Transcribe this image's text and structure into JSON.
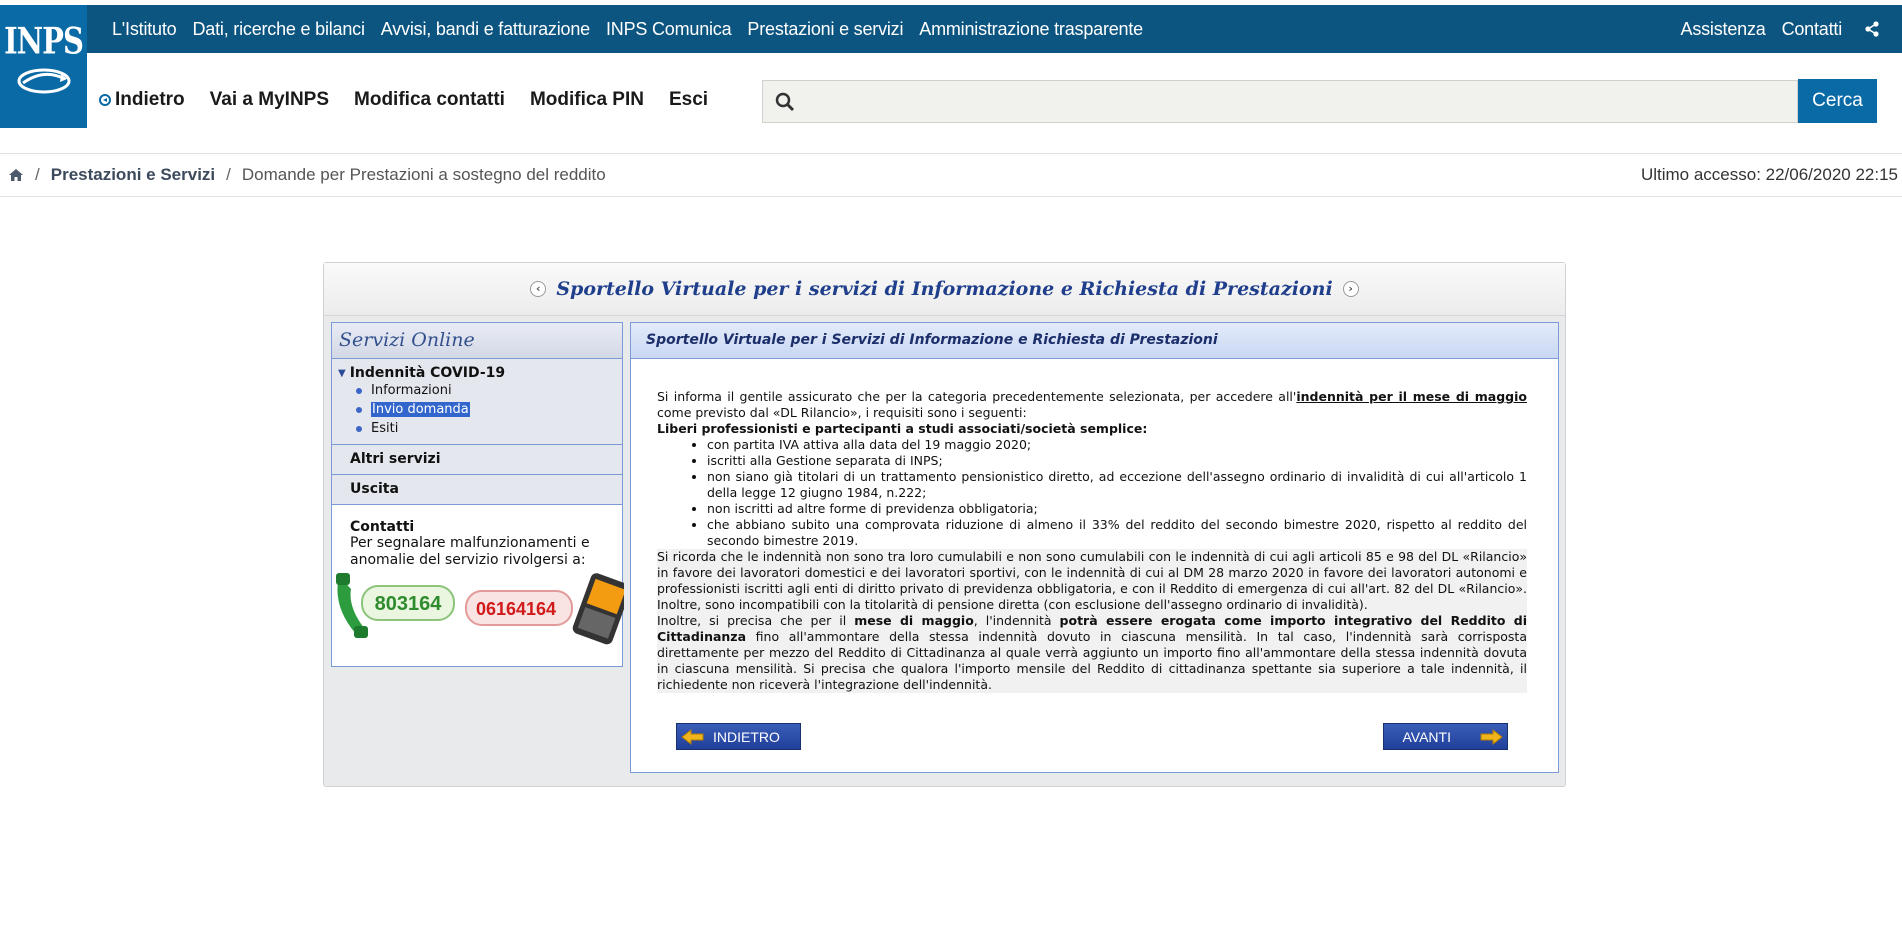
{
  "logo": {
    "text": "INPS"
  },
  "topnav": {
    "items": [
      "L'Istituto",
      "Dati, ricerche e bilanci",
      "Avvisi, bandi e fatturazione",
      "INPS Comunica",
      "Prestazioni e servizi",
      "Amministrazione trasparente"
    ],
    "assistenza": "Assistenza",
    "contatti": "Contatti",
    "share_icon": "share-icon"
  },
  "subnav": {
    "back": "Indietro",
    "myinps": "Vai a MyINPS",
    "contacts": "Modifica contatti",
    "pin": "Modifica PIN",
    "exit": "Esci"
  },
  "search": {
    "placeholder": "",
    "value": "",
    "button": "Cerca"
  },
  "breadcrumb": {
    "home_icon": "home-icon",
    "section": "Prestazioni e Servizi",
    "current": "Domande per Prestazioni a sostegno del reddito"
  },
  "last_access": "Ultimo accesso: 22/06/2020 22:15",
  "panel": {
    "title": "Sportello Virtuale per i servizi di Informazione e Richiesta di Prestazioni"
  },
  "sidebar": {
    "title": "Servizi Online",
    "group": "Indennità COVID-19",
    "sub_items": [
      "Informazioni",
      "Invio domanda",
      "Esiti"
    ],
    "altri": "Altri servizi",
    "uscita": "Uscita",
    "contacts_title": "Contatti",
    "contacts_text": "Per segnalare malfunzionamenti e anomalie del servizio rivolgersi a:",
    "phone1": "803164",
    "phone2": "06164164"
  },
  "content": {
    "header": "Sportello Virtuale per i Servizi di Informazione e Richiesta di Prestazioni",
    "intro_a": "Si informa il gentile assicurato che per la categoria precedentemente selezionata, per accedere all'",
    "intro_link": "indennità per il mese di maggio",
    "intro_b": " come previsto dal «DL Rilancio», i requisiti sono i seguenti:",
    "category": "Liberi professionisti e partecipanti a studi associati/società semplice:",
    "requirements": [
      "con partita IVA attiva alla data del 19 maggio 2020;",
      "iscritti alla Gestione separata di INPS;",
      "non siano già titolari di un trattamento pensionistico diretto, ad eccezione dell'assegno ordinario di invalidità di cui all'articolo 1 della legge 12 giugno 1984, n.222;",
      "non iscritti ad altre forme di previdenza obbligatoria;",
      "che abbiano subito una comprovata riduzione di almeno il 33% del reddito del secondo bimestre 2020, rispetto al reddito del secondo bimestre 2019."
    ],
    "note1": "Si ricorda che le indennità non sono tra loro cumulabili e non sono cumulabili con le indennità di cui agli articoli 85 e 98 del DL «Rilancio» in favore dei lavoratori domestici e dei lavoratori sportivi, con le indennità di cui al DM 28 marzo 2020 in favore dei lavoratori autonomi e professionisti iscritti agli enti di diritto privato di previdenza obbligatoria, e con il Reddito di emergenza di cui all'art. 82 del DL «Rilancio». Inoltre, sono incompatibili con la titolarità di pensione diretta (con esclusione dell'assegno ordinario di invalidità).",
    "note2_a": "Inoltre, si precisa che per il ",
    "note2_b1": "mese di maggio",
    "note2_c": ", l'indennità ",
    "note2_b2": "potrà essere erogata come importo integrativo del Reddito di Cittadinanza",
    "note2_d": " fino all'ammontare della stessa indennità dovuto in ciascuna mensilità. In tal caso, l'indennità sarà corrisposta direttamente per mezzo del Reddito di Cittadinanza al quale verrà aggiunto un importo fino all'ammontare della stessa indennità dovuta in ciascuna mensilità. Si precisa che qualora l'importo mensile del Reddito di cittadinanza spettante sia superiore a tale indennità, il richiedente non riceverà l'integrazione dell'indennità.",
    "btn_back": "INDIETRO",
    "btn_next": "AVANTI"
  },
  "colors": {
    "topbar": "#0d5581",
    "accent": "#0a6aa6",
    "panel_title": "#1f3f8c"
  }
}
